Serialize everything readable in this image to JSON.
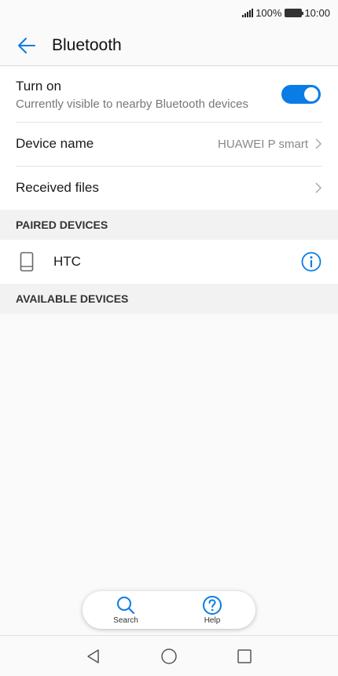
{
  "status_bar": {
    "battery": "100%",
    "time": "10:00"
  },
  "header": {
    "title": "Bluetooth"
  },
  "settings": {
    "turn_on": {
      "label": "Turn on",
      "subtitle": "Currently visible to nearby Bluetooth devices",
      "enabled": true
    },
    "device_name": {
      "label": "Device name",
      "value": "HUAWEI P smart"
    },
    "received_files": {
      "label": "Received files"
    }
  },
  "paired_section": {
    "header": "PAIRED DEVICES",
    "devices": [
      {
        "name": "HTC"
      }
    ]
  },
  "available_section": {
    "header": "AVAILABLE DEVICES"
  },
  "bottom_actions": {
    "search_label": "Search",
    "help_label": "Help"
  },
  "colors": {
    "accent": "#0a7ce6",
    "background": "#fafafa",
    "section_bg": "#f2f2f2"
  },
  "icons": [
    "signal-icon",
    "battery-icon",
    "back-arrow-icon",
    "chevron-right-icon",
    "phone-icon",
    "info-icon",
    "search-icon",
    "help-icon",
    "nav-back-icon",
    "nav-home-icon",
    "nav-recents-icon"
  ]
}
